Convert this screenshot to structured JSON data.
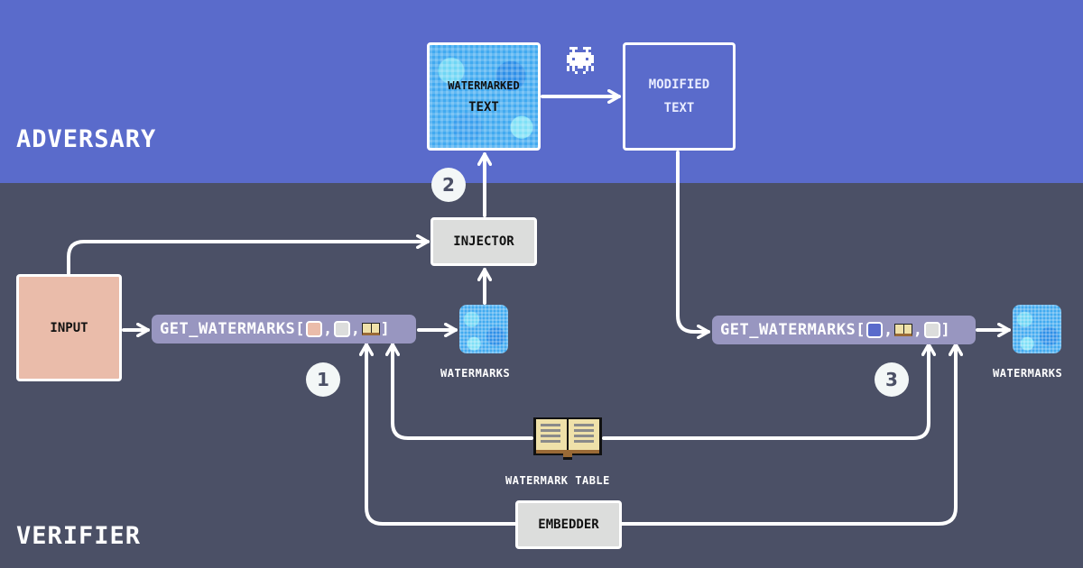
{
  "regions": {
    "adversary": {
      "label": "ADVERSARY",
      "color": "#5a6bcb"
    },
    "verifier": {
      "label": "VERIFIER",
      "color": "#4b5066"
    }
  },
  "nodes": {
    "input": {
      "label": "INPUT",
      "color": "#eabcaa"
    },
    "watermarked_text": {
      "line1": "WATERMARKED",
      "line2": "TEXT"
    },
    "modified_text": {
      "line1": "MODIFIED",
      "line2": "TEXT"
    },
    "injector": {
      "label": "INJECTOR"
    },
    "embedder": {
      "label": "EMBEDDER"
    },
    "get_watermarks_1": {
      "label": "GET_WATERMARKS[",
      "args": [
        "input-square",
        "embedder-square",
        "book-icon"
      ],
      "close": "]"
    },
    "get_watermarks_2": {
      "label": "GET_WATERMARKS[",
      "args": [
        "modified-text-square",
        "book-icon",
        "embedder-square"
      ],
      "close": "]"
    },
    "watermarks_1": {
      "caption": "WATERMARKS"
    },
    "watermarks_2": {
      "caption": "WATERMARKS"
    },
    "watermark_table": {
      "caption": "WATERMARK TABLE",
      "icon": "open-book-icon"
    },
    "adversary_icon": {
      "icon": "space-invader-icon"
    }
  },
  "steps": [
    {
      "number": "1"
    },
    {
      "number": "2"
    },
    {
      "number": "3"
    }
  ],
  "separators": {
    "comma": ","
  }
}
